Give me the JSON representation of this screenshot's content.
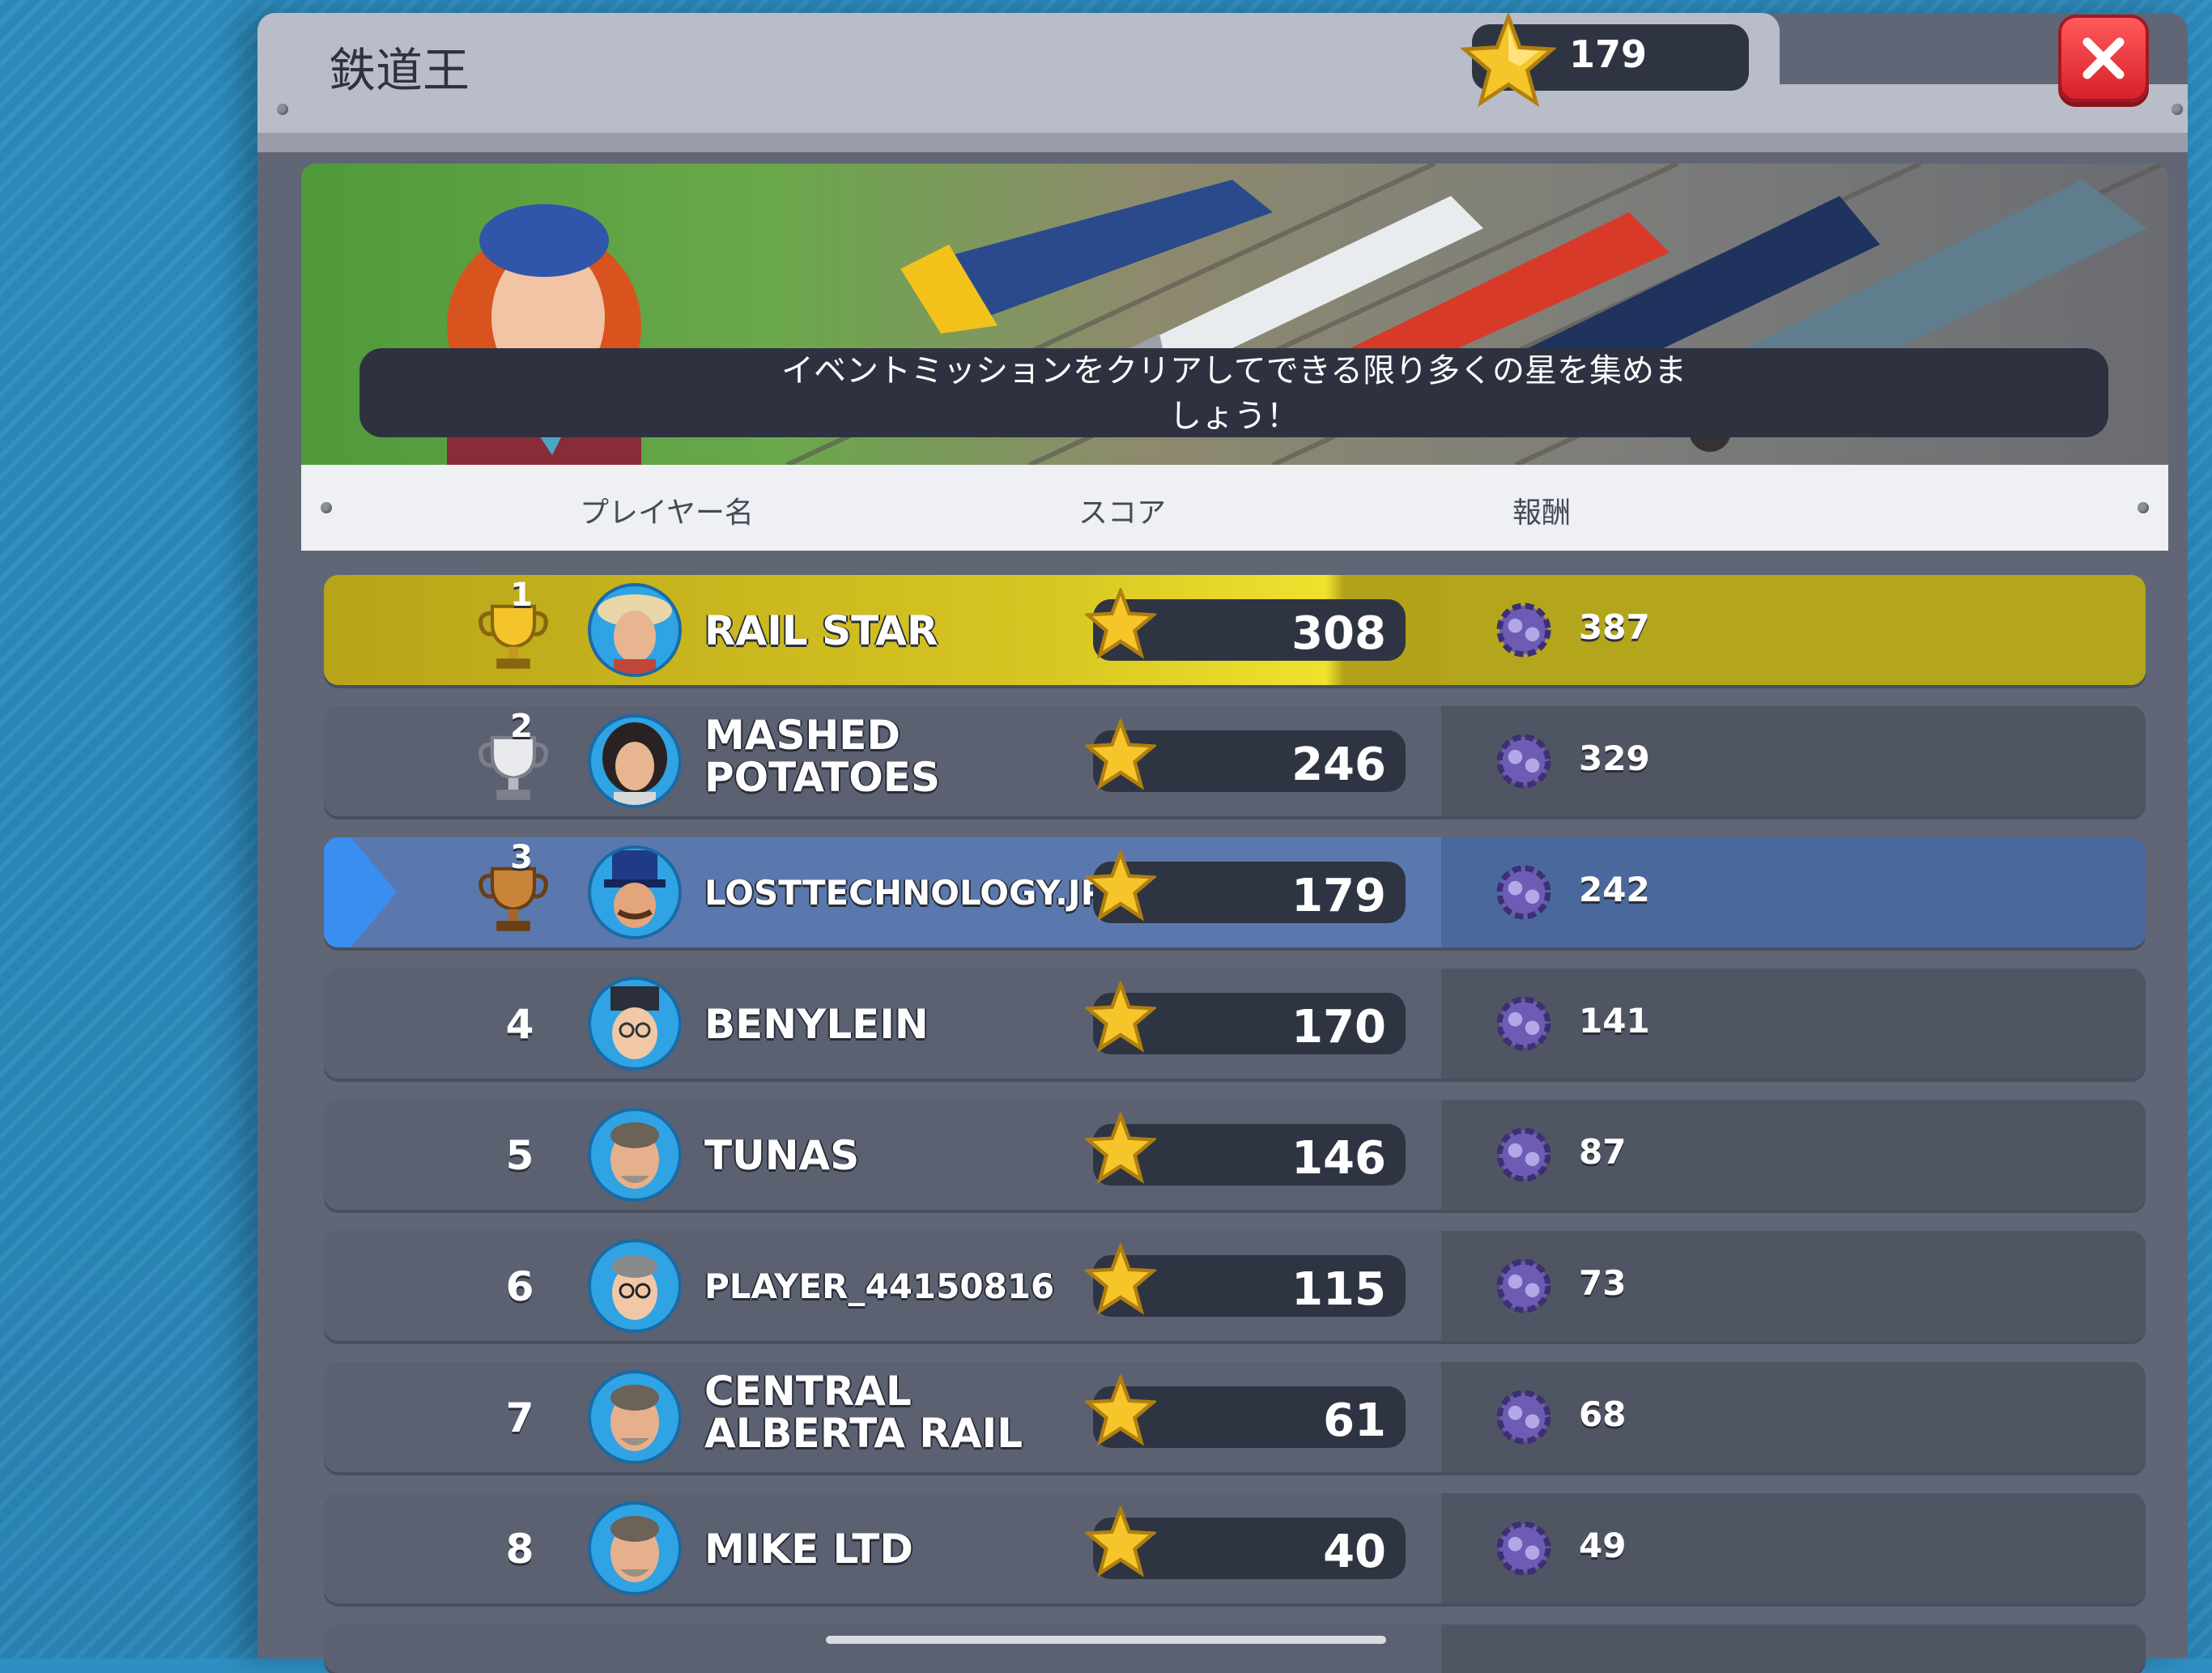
{
  "window": {
    "title": "鉄道王",
    "star_count": "179"
  },
  "banner": {
    "message_line1": "イベントミッションをクリアしてできる限り多くの星を集めま",
    "message_line2": "しょう！"
  },
  "columns": {
    "player": "プレイヤー名",
    "score": "スコア",
    "reward": "報酬"
  },
  "rows": [
    {
      "rank": "1",
      "name": "RAIL STAR",
      "score": "308",
      "reward": "387"
    },
    {
      "rank": "2",
      "name": "MASHED",
      "name2": "POTATOES",
      "score": "246",
      "reward": "329"
    },
    {
      "rank": "3",
      "name": "LOSTTECHNOLOGY.JP",
      "score": "179",
      "reward": "242"
    },
    {
      "rank": "4",
      "name": "BENYLEIN",
      "score": "170",
      "reward": "141"
    },
    {
      "rank": "5",
      "name": "TUNAS",
      "score": "146",
      "reward": "87"
    },
    {
      "rank": "6",
      "name": "PLAYER_44150816",
      "score": "115",
      "reward": "73"
    },
    {
      "rank": "7",
      "name": "CENTRAL",
      "name2": "ALBERTA RAIL",
      "score": "61",
      "reward": "68"
    },
    {
      "rank": "8",
      "name": "MIKE LTD",
      "score": "40",
      "reward": "49"
    }
  ],
  "colors": {
    "gold_row": "#d8c622",
    "my_row": "#5a78ad",
    "row": "#5b6170",
    "close_button": "#e0313a"
  },
  "icons": {
    "star": "star-icon",
    "reward": "gear-icon",
    "close": "close-icon",
    "trophy": "trophy-icon"
  }
}
